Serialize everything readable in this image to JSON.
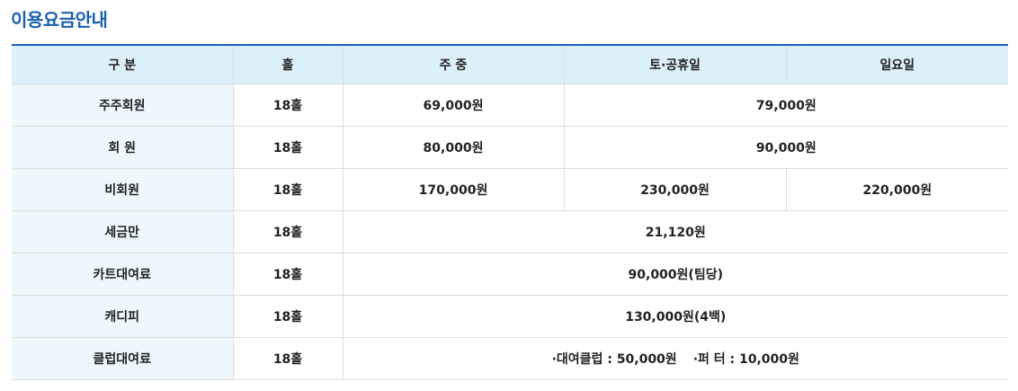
{
  "title": "이용요금안내",
  "headers": [
    "구 분",
    "홀",
    "주 중",
    "토·공휴일",
    "일요일"
  ],
  "rows": [
    {
      "category": "주주회원",
      "holes": "18홀",
      "weekday": "69,000원",
      "weekend": "79,000원"
    },
    {
      "category": "회 원",
      "holes": "18홀",
      "weekday": "80,000원",
      "weekend": "90,000원"
    },
    {
      "category": "비회원",
      "holes": "18홀",
      "weekday": "170,000원",
      "saturday": "230,000원",
      "sunday": "220,000원"
    },
    {
      "category": "세금만",
      "holes": "18홀",
      "all": "21,120원"
    },
    {
      "category": "카트대여료",
      "holes": "18홀",
      "all": "90,000원(팀당)"
    },
    {
      "category": "캐디피",
      "holes": "18홀",
      "all": "130,000원(4백)"
    },
    {
      "category": "클럽대여료",
      "holes": "18홀",
      "club": "·대여클럽 : 50,000원",
      "putter": "·퍼 터 : 10,000원"
    }
  ]
}
